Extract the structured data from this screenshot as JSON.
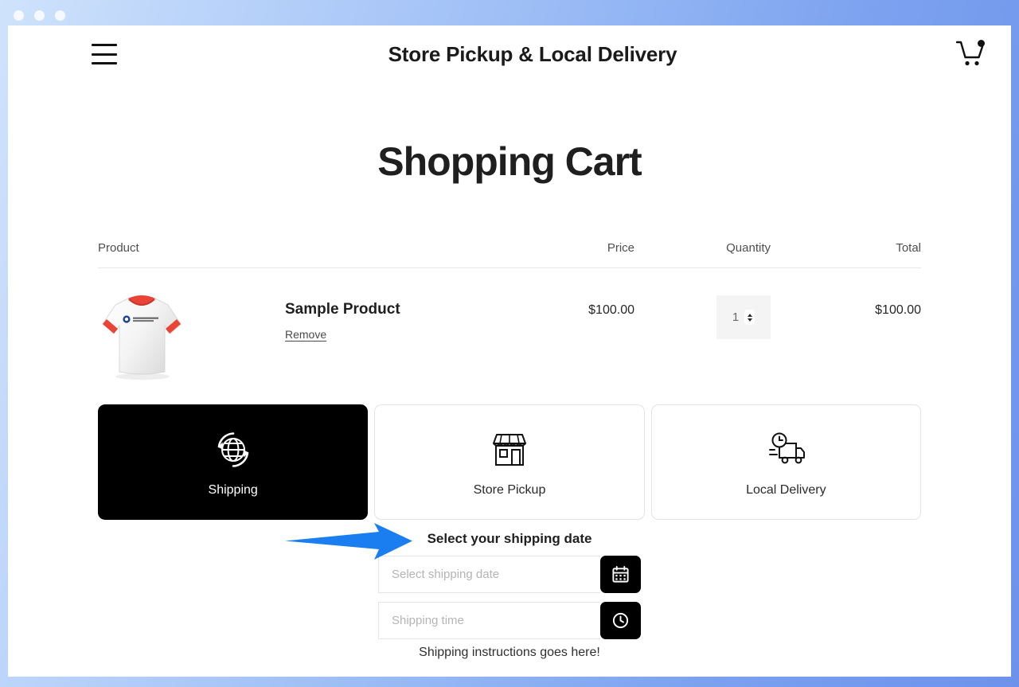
{
  "window_chrome": {
    "dots": [
      "close-dot",
      "minimize-dot",
      "maximize-dot"
    ]
  },
  "header": {
    "menu_icon": "hamburger-icon",
    "title": "Store Pickup & Local Delivery",
    "cart_icon": "shopping-cart-icon"
  },
  "page": {
    "title": "Shopping Cart"
  },
  "cart": {
    "columns": {
      "product": "Product",
      "price": "Price",
      "quantity": "Quantity",
      "total": "Total"
    },
    "items": [
      {
        "image_alt": "white t-shirt with red trim",
        "image_logo_text": "Order Delivery Date",
        "name": "Sample Product",
        "remove_label": "Remove",
        "price": "$100.00",
        "quantity": "1",
        "total": "$100.00"
      }
    ]
  },
  "delivery_methods": [
    {
      "label": "Shipping",
      "icon": "globe-arrows-icon",
      "active": true
    },
    {
      "label": "Store Pickup",
      "icon": "storefront-icon",
      "active": false
    },
    {
      "label": "Local Delivery",
      "icon": "delivery-truck-clock-icon",
      "active": false
    }
  ],
  "shipping_form": {
    "label": "Select your shipping date",
    "date_placeholder": "Select shipping date",
    "date_value": "",
    "date_button_icon": "calendar-icon",
    "time_placeholder": "Shipping time",
    "time_value": "",
    "time_button_icon": "clock-icon",
    "instructions": "Shipping instructions goes here!"
  },
  "annotation": {
    "arrow_color": "#1a7ef0",
    "points_to": "Select your shipping date"
  }
}
